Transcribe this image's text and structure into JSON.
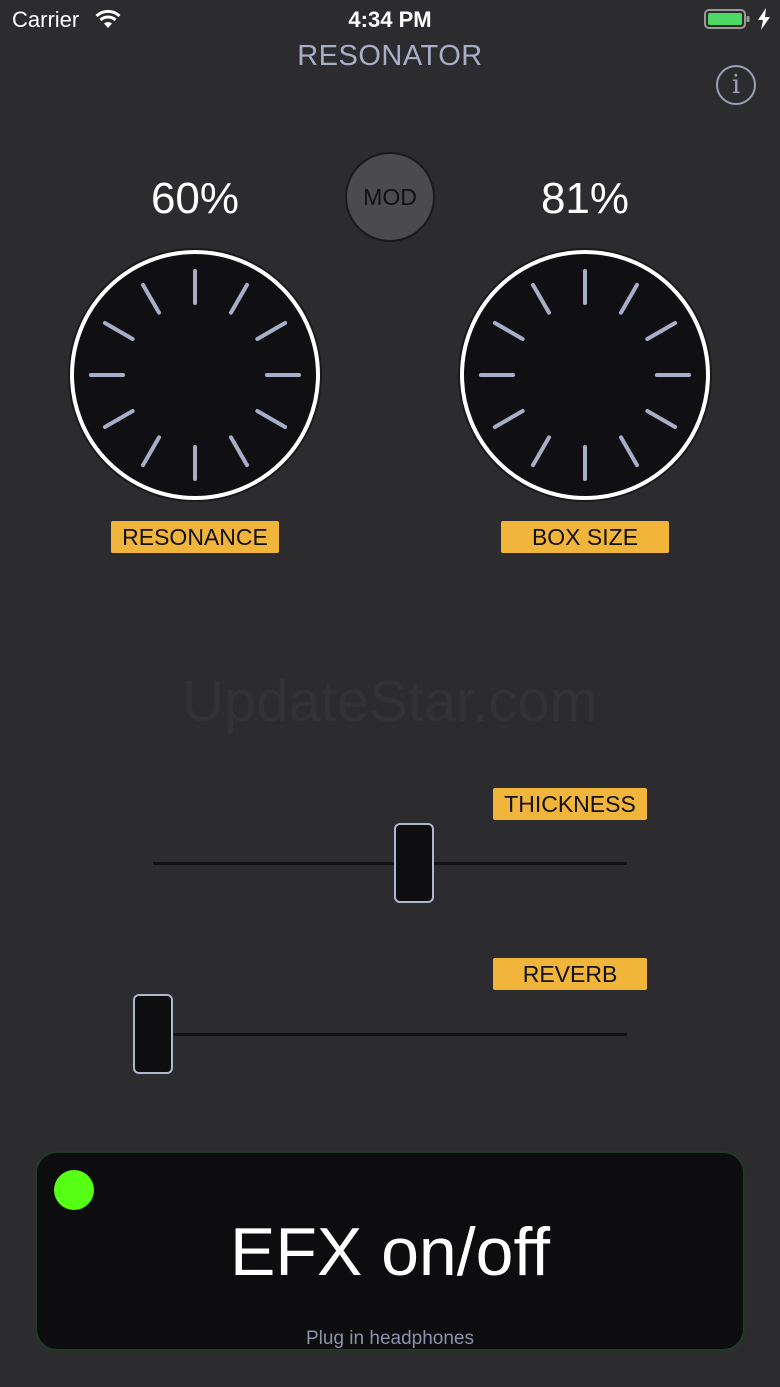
{
  "status_bar": {
    "carrier": "Carrier",
    "time": "4:34 PM",
    "battery_color": "#4cd964"
  },
  "app": {
    "title": "RESONATOR"
  },
  "info_button": {
    "glyph": "i"
  },
  "mod_button": {
    "label": "MOD"
  },
  "knobs": [
    {
      "name": "resonance",
      "value_text": "60%",
      "label": "RESONANCE",
      "value": 0.6
    },
    {
      "name": "box-size",
      "value_text": "81%",
      "label": "BOX SIZE",
      "value": 0.81
    }
  ],
  "watermark": "UpdateStar.com",
  "sliders": [
    {
      "name": "thickness",
      "label": "THICKNESS",
      "value": 0.55
    },
    {
      "name": "reverb",
      "label": "REVERB",
      "value": 0.0
    }
  ],
  "efx": {
    "label": "EFX on/off",
    "hint": "Plug in headphones",
    "led_color": "#56ff14"
  },
  "colors": {
    "background": "#2c2c2e",
    "tag": "#f2b53c",
    "tick": "#a8aec8"
  }
}
